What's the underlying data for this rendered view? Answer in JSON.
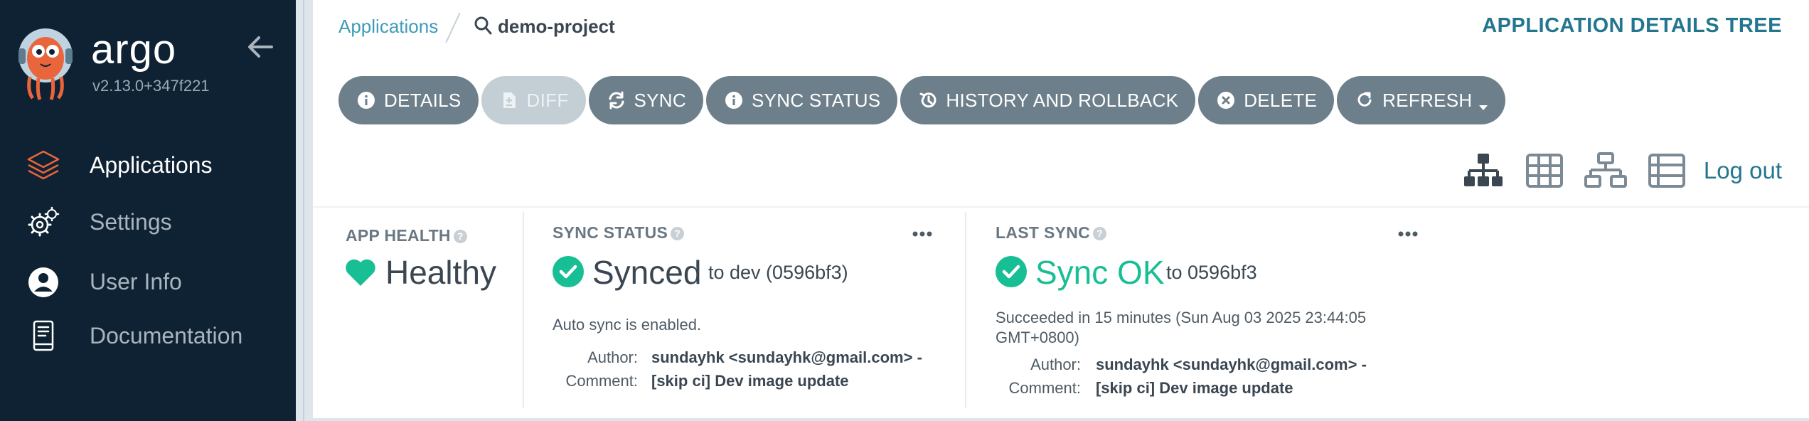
{
  "sidebar": {
    "brand": "argo",
    "version": "v2.13.0+347f221",
    "items": [
      {
        "label": "Applications",
        "icon": "layers-icon",
        "active": true
      },
      {
        "label": "Settings",
        "icon": "gears-icon",
        "active": false
      },
      {
        "label": "User Info",
        "icon": "user-circle-icon",
        "active": false
      },
      {
        "label": "Documentation",
        "icon": "book-icon",
        "active": false
      }
    ]
  },
  "breadcrumb": {
    "root": "Applications",
    "current": "demo-project"
  },
  "header": {
    "view_title": "APPLICATION DETAILS TREE"
  },
  "toolbar": {
    "details": "DETAILS",
    "diff": "DIFF",
    "sync": "SYNC",
    "sync_status": "SYNC STATUS",
    "history": "HISTORY AND ROLLBACK",
    "delete": "DELETE",
    "refresh": "REFRESH"
  },
  "views": {
    "logout": "Log out"
  },
  "app_health": {
    "title": "APP HEALTH",
    "status": "Healthy"
  },
  "sync_status": {
    "title": "SYNC STATUS",
    "status": "Synced",
    "target": "to dev (0596bf3)",
    "auto_sync": "Auto sync is enabled.",
    "author_label": "Author:",
    "author": "sundayhk <sundayhk@gmail.com> -",
    "comment_label": "Comment:",
    "comment": "[skip ci] Dev image update"
  },
  "last_sync": {
    "title": "LAST SYNC",
    "status": "Sync OK",
    "target": "to 0596bf3",
    "detail_line1": "Succeeded in 15 minutes (Sun Aug 03 2025 23:44:05",
    "detail_line2": "GMT+0800)",
    "author_label": "Author:",
    "author": "sundayhk <sundayhk@gmail.com> -",
    "comment_label": "Comment:",
    "comment": "[skip ci] Dev image update"
  },
  "colors": {
    "sidebar_bg": "#0e2233",
    "accent": "#24768f",
    "healthy": "#18be94",
    "button": "#6d7f8b"
  }
}
